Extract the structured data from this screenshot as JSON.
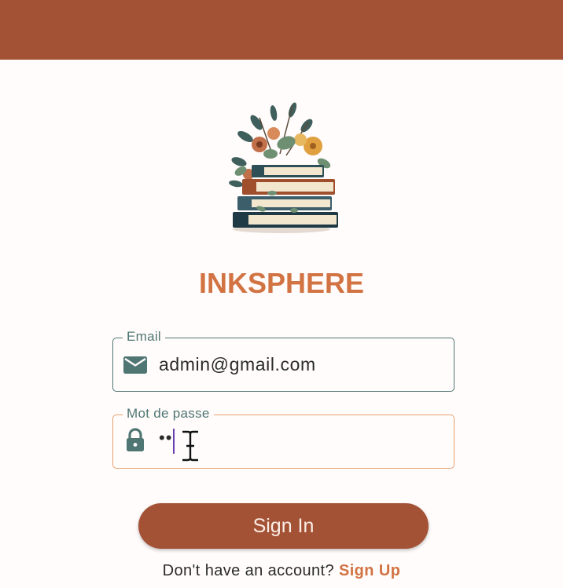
{
  "app": {
    "name": "INKSPHERE"
  },
  "colors": {
    "appbar": "#a35235",
    "brand": "#d27343",
    "field_border_focused": "#e8a070",
    "field_border": "#4f7673",
    "button": "#a35235",
    "caret": "#6a3fb0"
  },
  "logo": {
    "icon": "books-with-flowers-illustration"
  },
  "form": {
    "email": {
      "label": "Email",
      "value": "admin@gmail.com",
      "icon": "mail-icon"
    },
    "password": {
      "label": "Mot de passe",
      "value": "••",
      "icon": "lock-icon"
    },
    "submit_label": "Sign In"
  },
  "footer": {
    "prompt": "Don't have an account?",
    "link": "Sign Up"
  }
}
